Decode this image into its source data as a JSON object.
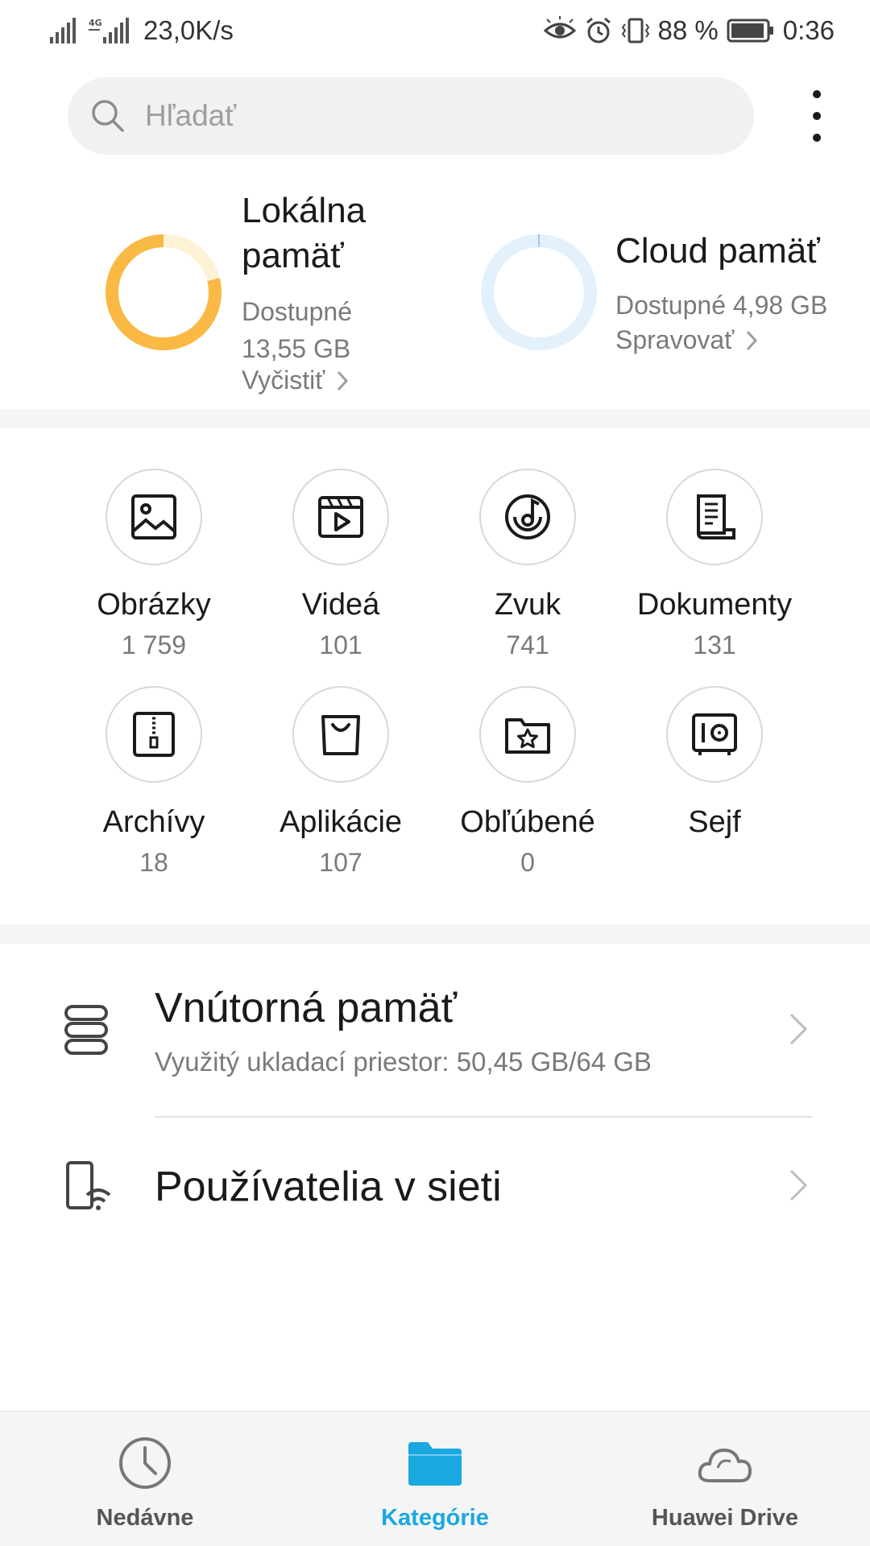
{
  "status_bar": {
    "network_speed": "23,0K/s",
    "network_type": "4G",
    "battery": "88 %",
    "time": "0:36"
  },
  "search": {
    "placeholder": "Hľadať"
  },
  "storage": {
    "local": {
      "title": "Lokálna pamäť",
      "available": "Dostupné 13,55 GB",
      "action": "Vyčistiť",
      "ring_color": "#f9b944",
      "ring_track_color": "#fdf1d6",
      "used_fraction": 0.79
    },
    "cloud": {
      "title": "Cloud pamäť",
      "available": "Dostupné 4,98 GB",
      "action": "Spravovať",
      "ring_color": "#e3f1fd",
      "used_fraction": 0.0
    }
  },
  "categories": [
    {
      "label": "Obrázky",
      "count": "1 759",
      "icon": "image-icon"
    },
    {
      "label": "Videá",
      "count": "101",
      "icon": "video-icon"
    },
    {
      "label": "Zvuk",
      "count": "741",
      "icon": "audio-icon"
    },
    {
      "label": "Dokumenty",
      "count": "131",
      "icon": "document-icon"
    },
    {
      "label": "Archívy",
      "count": "18",
      "icon": "archive-icon"
    },
    {
      "label": "Aplikácie",
      "count": "107",
      "icon": "app-bag-icon"
    },
    {
      "label": "Obľúbené",
      "count": "0",
      "icon": "favorite-folder-icon"
    },
    {
      "label": "Sejf",
      "count": "",
      "icon": "safe-icon"
    }
  ],
  "list": {
    "internal": {
      "title": "Vnútorná pamäť",
      "subtitle": "Využitý ukladací priestor: 50,45 GB/64 GB"
    },
    "network": {
      "title": "Používatelia v sieti"
    }
  },
  "bottom_nav": [
    {
      "label": "Nedávne",
      "icon": "clock-icon"
    },
    {
      "label": "Kategórie",
      "icon": "folder-icon",
      "active": true
    },
    {
      "label": "Huawei Drive",
      "icon": "cloud-icon"
    }
  ],
  "colors": {
    "accent": "#1aa8e0",
    "local_ring": "#f9b944",
    "cloud_ring": "#e3f1fd"
  }
}
